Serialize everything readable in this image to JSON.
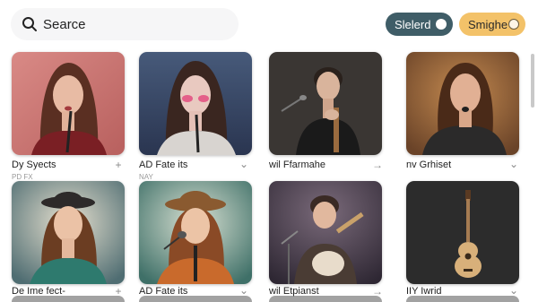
{
  "search": {
    "value": "Searce"
  },
  "filters": {
    "selected_label": "Slelerd",
    "smart_label": "Smighe"
  },
  "cards": [
    {
      "title": "Dy   Syects",
      "sub": "PD   FX",
      "action_icon": "plus-icon",
      "action_glyph": "+"
    },
    {
      "title": "AD   Fate its",
      "sub": "NAY",
      "action_icon": "chevron-down-icon",
      "action_glyph": "⌄"
    },
    {
      "title": "wil   Ffarmahe",
      "sub": "",
      "action_icon": "arrow-right-icon",
      "action_glyph": "→"
    },
    {
      "title": "nv   Grhiset",
      "sub": "",
      "action_icon": "chevron-down-icon",
      "action_glyph": "⌄"
    },
    {
      "title": "De   Ime fect-",
      "sub": "",
      "action_icon": "plus-icon",
      "action_glyph": "+"
    },
    {
      "title": "AD   Fate its",
      "sub": "",
      "action_icon": "chevron-down-icon",
      "action_glyph": "⌄"
    },
    {
      "title": "wil   Etpianst",
      "sub": "",
      "action_icon": "arrow-right-icon",
      "action_glyph": "→"
    },
    {
      "title": "IIY   Iwrid",
      "sub": "",
      "action_icon": "chevron-down-icon",
      "action_glyph": "⌄"
    }
  ],
  "colors": {
    "selected_pill": "#3f5d67",
    "smart_pill": "#f3c269"
  }
}
